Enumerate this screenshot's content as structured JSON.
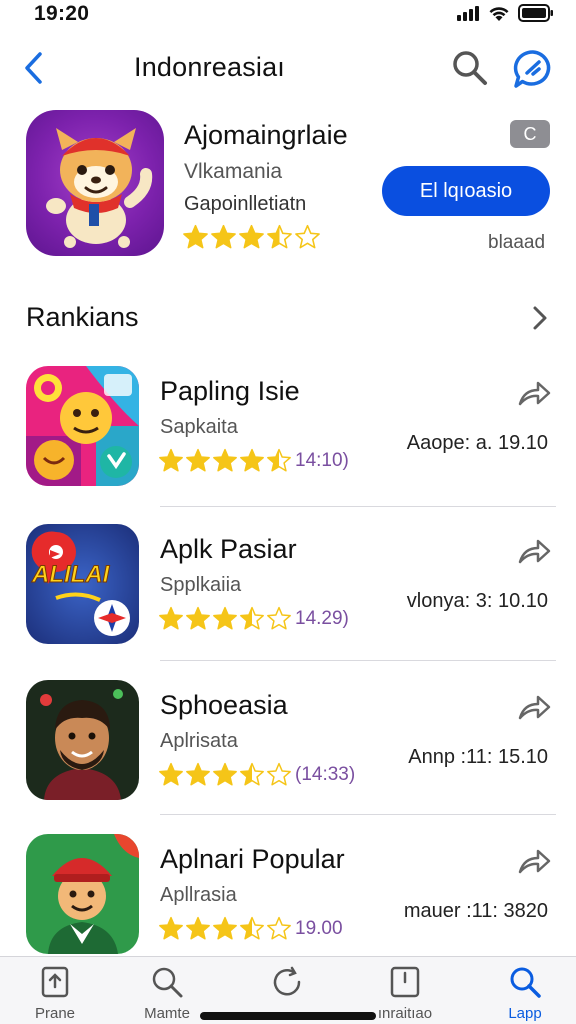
{
  "status": {
    "time": "19:20"
  },
  "nav": {
    "title": "Indonreasiaı"
  },
  "featured": {
    "title": "Ajomaingrlaie",
    "subtitle1": "Vlkamania",
    "subtitle2": "Gapoinlletiatn",
    "rating": 3.5,
    "badge": "C",
    "button_label": "El lqıoasio",
    "note": "blaaad"
  },
  "section": {
    "title": "Rankians"
  },
  "rankings": [
    {
      "title": "Papling Isie",
      "subtitle": "Sapkaita",
      "rating": 4.5,
      "count": "14:10)",
      "meta": "Aaope: a. 19.10"
    },
    {
      "title": "Aplk Pasiar",
      "subtitle": "Spplkaiia",
      "rating": 3.5,
      "count": "14.29)",
      "meta": "vlonya: 3: 10.10"
    },
    {
      "title": "Sphoeasia",
      "subtitle": "Aplrisata",
      "rating": 3.5,
      "count": "(14:33)",
      "meta": "Annp :11: 15.10"
    },
    {
      "title": "Aplnari Popular",
      "subtitle": "Apllrasia",
      "rating": 3.5,
      "count": "19.00",
      "meta": "mauer :11: 3820"
    }
  ],
  "icons": {
    "featured": {
      "text": ""
    },
    "rank2_banner": "ALILAI"
  },
  "tabs": [
    {
      "label": "Prane",
      "icon": "doc-icon"
    },
    {
      "label": "Mamte",
      "icon": "search-icon"
    },
    {
      "label": "",
      "icon": "refresh-icon"
    },
    {
      "label": "ınraitıao",
      "icon": "box-icon"
    },
    {
      "label": "Lapp",
      "icon": "search-icon"
    }
  ],
  "colors": {
    "accent": "#0a4fe0",
    "star": "#f5c518",
    "tab_active": "#0a5ce0"
  }
}
